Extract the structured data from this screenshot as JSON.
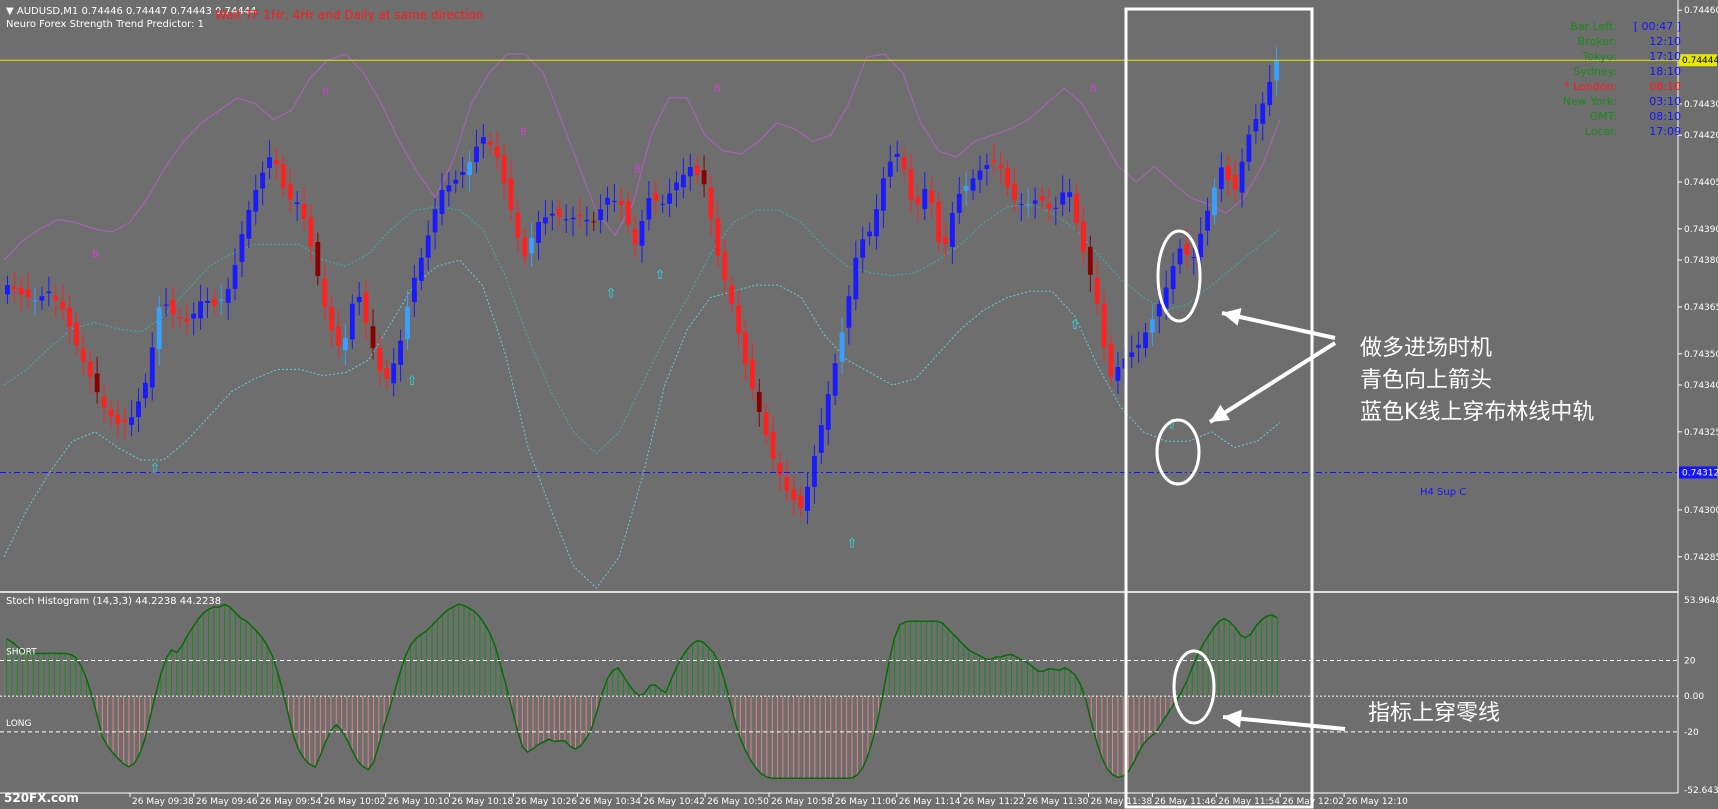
{
  "header": {
    "symbol_line": "AUDUSD,M1  0.74446 0.74447 0.74443 0.74444",
    "indicator_line": "Neuro Forex Strength Trend Predictor: 1",
    "warning": "Wait TF 1Hr, 4Hr and Daily at same direction"
  },
  "info_panel": {
    "rows": [
      {
        "label": "Bar Left:",
        "value": "[ 00:47 ]",
        "label_color": "#1a8c1a",
        "value_color": "#1414ff"
      },
      {
        "label": "Broker:",
        "value": "12:10",
        "label_color": "#1a8c1a",
        "value_color": "#1414ff"
      },
      {
        "label": "Tokyo:",
        "value": "17:10",
        "label_color": "#1a8c1a",
        "value_color": "#1414ff"
      },
      {
        "label": "Sydney:",
        "value": "18:10",
        "label_color": "#1a8c1a",
        "value_color": "#1414ff"
      },
      {
        "label": "* London:",
        "value": "08:10",
        "label_color": "#ff1a1a",
        "value_color": "#ff1a1a"
      },
      {
        "label": "New York:",
        "value": "03:10",
        "label_color": "#1a8c1a",
        "value_color": "#1414ff"
      },
      {
        "label": "GMT:",
        "value": "08:10",
        "label_color": "#1a8c1a",
        "value_color": "#1414ff"
      },
      {
        "label": "Local:",
        "value": "17:09",
        "label_color": "#1a8c1a",
        "value_color": "#1414ff"
      }
    ]
  },
  "annotations": {
    "entry_lines": [
      "做多进场时机",
      "青色向上箭头",
      "蓝色K线上穿布林线中轨"
    ],
    "indicator_note": "指标上穿零线"
  },
  "support_label": "H4 Sup C",
  "watermark": "520FX.com",
  "chart_data": [
    {
      "type": "candlestick",
      "symbol": "AUDUSD",
      "timeframe": "M1",
      "price_axis_ticks": [
        "0.74460",
        "0.74430",
        "0.74420",
        "0.74405",
        "0.74390",
        "0.74380",
        "0.74365",
        "0.74350",
        "0.74340",
        "0.74325",
        "0.74300",
        "0.74285"
      ],
      "price_axis_values": [
        0.7446,
        0.7443,
        0.7442,
        0.74405,
        0.7439,
        0.7438,
        0.74365,
        0.7435,
        0.7434,
        0.74325,
        0.743,
        0.74285
      ],
      "current_price_label": "0.74444",
      "current_price": 0.74444,
      "support_price_label": "0.74312",
      "support_price": 0.74312,
      "time_axis_labels": [
        "26 May 09:38",
        "26 May 09:46",
        "26 May 09:54",
        "26 May 10:02",
        "26 May 10:10",
        "26 May 10:18",
        "26 May 10:26",
        "26 May 10:34",
        "26 May 10:42",
        "26 May 10:50",
        "26 May 10:58",
        "26 May 11:06",
        "26 May 11:14",
        "26 May 11:22",
        "26 May 11:30",
        "26 May 11:38",
        "26 May 11:46",
        "26 May 11:54",
        "26 May 12:02",
        "26 May 12:10"
      ],
      "close_path": [
        0.74372,
        0.74369,
        0.74367,
        0.7437,
        0.74364,
        0.74352,
        0.74342,
        0.74332,
        0.74327,
        0.7433,
        0.74342,
        0.74368,
        0.74362,
        0.7436,
        0.74368,
        0.74365,
        0.74372,
        0.74392,
        0.74405,
        0.74415,
        0.744,
        0.74398,
        0.7438,
        0.7436,
        0.7435,
        0.74372,
        0.74355,
        0.7434,
        0.7435,
        0.74372,
        0.74385,
        0.74402,
        0.74405,
        0.7441,
        0.7442,
        0.74415,
        0.74398,
        0.7438,
        0.74392,
        0.74395,
        0.74393,
        0.74394,
        0.74392,
        0.744,
        0.74398,
        0.74385,
        0.744,
        0.74398,
        0.74405,
        0.7441,
        0.74404,
        0.7438,
        0.74365,
        0.74345,
        0.7433,
        0.74315,
        0.74305,
        0.743,
        0.7432,
        0.7434,
        0.7436,
        0.74385,
        0.7439,
        0.7441,
        0.74415,
        0.74395,
        0.74405,
        0.7438,
        0.744,
        0.74405,
        0.7441,
        0.74412,
        0.744,
        0.74397,
        0.744,
        0.74395,
        0.74405,
        0.74385,
        0.7437,
        0.74342,
        0.74348,
        0.74352,
        0.7436,
        0.7437,
        0.74384,
        0.7438,
        0.74395,
        0.7441,
        0.74402,
        0.7442,
        0.7443,
        0.74444
      ],
      "boll_upper": [
        0.7438,
        0.74386,
        0.7439,
        0.74393,
        0.74392,
        0.7439,
        0.74389,
        0.74392,
        0.744,
        0.7441,
        0.74418,
        0.74424,
        0.74428,
        0.74432,
        0.7443,
        0.74425,
        0.74428,
        0.74438,
        0.74444,
        0.74446,
        0.7444,
        0.7443,
        0.74418,
        0.74408,
        0.744,
        0.74412,
        0.7443,
        0.7444,
        0.74446,
        0.74446,
        0.7444,
        0.74425,
        0.7441,
        0.74395,
        0.74388,
        0.74398,
        0.7442,
        0.74432,
        0.74432,
        0.7442,
        0.74415,
        0.74414,
        0.74418,
        0.74424,
        0.74422,
        0.74418,
        0.7442,
        0.7443,
        0.74445,
        0.74446,
        0.7444,
        0.74424,
        0.74415,
        0.74413,
        0.74418,
        0.7442,
        0.74422,
        0.74425,
        0.7443,
        0.74435,
        0.7443,
        0.7442,
        0.7441,
        0.74405,
        0.7441,
        0.74405,
        0.744,
        0.74398,
        0.74395,
        0.744,
        0.7441,
        0.74425
      ],
      "boll_middle": [
        0.7434,
        0.74345,
        0.74352,
        0.74358,
        0.7436,
        0.74358,
        0.74357,
        0.74362,
        0.7437,
        0.74378,
        0.74382,
        0.74385,
        0.74385,
        0.74385,
        0.7438,
        0.74378,
        0.74382,
        0.7439,
        0.74396,
        0.74397,
        0.74396,
        0.7439,
        0.74375,
        0.74355,
        0.74338,
        0.74325,
        0.74318,
        0.74325,
        0.7434,
        0.74355,
        0.74368,
        0.74382,
        0.74392,
        0.74396,
        0.74396,
        0.74392,
        0.74384,
        0.74378,
        0.74376,
        0.74375,
        0.74376,
        0.7438,
        0.74385,
        0.74392,
        0.74397,
        0.74398,
        0.74395,
        0.7439,
        0.74382,
        0.74374,
        0.74368,
        0.74364,
        0.74366,
        0.74372,
        0.74378,
        0.74384,
        0.7439
      ],
      "boll_lower": [
        0.74285,
        0.743,
        0.74312,
        0.74322,
        0.74325,
        0.7432,
        0.74316,
        0.74316,
        0.74322,
        0.7433,
        0.74338,
        0.74342,
        0.74345,
        0.74345,
        0.74343,
        0.74344,
        0.74348,
        0.7436,
        0.74372,
        0.74378,
        0.7438,
        0.74372,
        0.7435,
        0.7432,
        0.743,
        0.74282,
        0.74275,
        0.74285,
        0.7431,
        0.7434,
        0.74358,
        0.74368,
        0.7437,
        0.74372,
        0.74372,
        0.74368,
        0.74356,
        0.74348,
        0.74344,
        0.7434,
        0.74342,
        0.7435,
        0.74358,
        0.74364,
        0.74368,
        0.7437,
        0.7437,
        0.74362,
        0.74346,
        0.74333,
        0.74325,
        0.74322,
        0.74322,
        0.74325,
        0.7432,
        0.74322,
        0.74328
      ],
      "legend": "none",
      "grid": false
    },
    {
      "type": "histogram",
      "title": "Stoch Histogram (14,3,3) 44.2238 44.2238",
      "ylim": [
        -52.6432,
        53.9648
      ],
      "axis_ticks": [
        "53.9648",
        "20",
        "0.00",
        "-20",
        "-52.6432"
      ],
      "axis_values": [
        53.9648,
        20,
        0,
        -20,
        -52.6432
      ],
      "levels": [
        {
          "name": "SHORT",
          "value": 20
        },
        {
          "name": "LONG",
          "value": -20
        }
      ],
      "values": [
        32,
        30,
        26,
        24,
        24,
        24,
        24,
        24,
        24,
        24,
        22,
        16,
        6,
        -8,
        -24,
        -30,
        -34,
        -38,
        -40,
        -36,
        -26,
        -10,
        6,
        20,
        26,
        24,
        32,
        38,
        44,
        48,
        50,
        50,
        52,
        48,
        44,
        42,
        38,
        34,
        28,
        20,
        6,
        -10,
        -26,
        -34,
        -38,
        -40,
        -30,
        -20,
        -16,
        -20,
        -28,
        -36,
        -40,
        -42,
        -30,
        -16,
        -4,
        10,
        22,
        30,
        34,
        36,
        40,
        44,
        48,
        50,
        52,
        50,
        48,
        44,
        38,
        30,
        16,
        2,
        -14,
        -28,
        -32,
        -28,
        -26,
        -24,
        -26,
        -24,
        -28,
        -30,
        -26,
        -20,
        -8,
        6,
        14,
        16,
        10,
        4,
        0,
        2,
        8,
        4,
        2,
        12,
        20,
        26,
        30,
        32,
        28,
        24,
        16,
        2,
        -14,
        -26,
        -34,
        -40,
        -44,
        -46,
        -46,
        -46,
        -46,
        -46,
        -46,
        -46,
        -46,
        -46,
        -46,
        -46,
        -46,
        -46,
        -44,
        -38,
        -26,
        -10,
        10,
        30,
        40,
        42,
        42,
        42,
        42,
        42,
        42,
        38,
        34,
        30,
        26,
        24,
        22,
        20,
        22,
        22,
        24,
        22,
        20,
        18,
        14,
        14,
        16,
        14,
        16,
        14,
        10,
        0,
        -16,
        -30,
        -40,
        -44,
        -46,
        -44,
        -38,
        -30,
        -24,
        -22,
        -16,
        -10,
        -4,
        2,
        10,
        20,
        28,
        34,
        40,
        44,
        42,
        38,
        32,
        34,
        40,
        44,
        46,
        44
      ]
    }
  ]
}
